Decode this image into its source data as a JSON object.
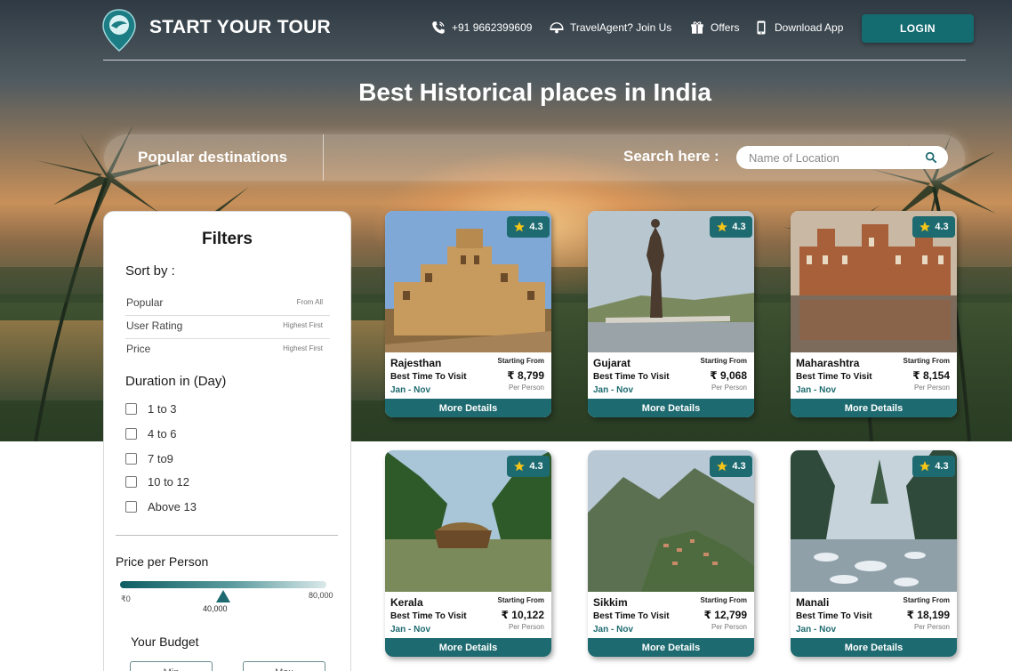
{
  "header": {
    "brand": "START YOUR TOUR",
    "phone": "+91 9662399609",
    "travel_agent": "TravelAgent? Join Us",
    "offers": "Offers",
    "download_app": "Download App",
    "login": "LOGIN"
  },
  "page_title": "Best Historical places in India",
  "search_bar": {
    "popular": "Popular destinations",
    "label": "Search here :",
    "placeholder": "Name of Location"
  },
  "filters": {
    "title": "Filters",
    "sort_by": "Sort by :",
    "sort_options": [
      {
        "label": "Popular",
        "hint": "From All"
      },
      {
        "label": "User Rating",
        "hint": "Highest First"
      },
      {
        "label": "Price",
        "hint": "Highest First"
      }
    ],
    "duration_title": "Duration in (Day)",
    "durations": [
      "1 to 3",
      "4 to 6",
      "7 to9",
      "10 to 12",
      "Above 13"
    ],
    "price_title": "Price per Person",
    "price_min": "₹0",
    "price_max": "80,000",
    "price_value": "40,000",
    "price_fraction": 0.5,
    "budget_title": "Your Budget",
    "budget_min": "Min",
    "budget_max": "Max"
  },
  "cards": [
    {
      "name": "Rajesthan",
      "rating": "4.3",
      "best": "Best Time To Visit",
      "months": "Jan - Nov",
      "from": "Starting From",
      "price": "₹ 8,799",
      "per": "Per Person",
      "button": "More Details"
    },
    {
      "name": "Gujarat",
      "rating": "4.3",
      "best": "Best Time To Visit",
      "months": "Jan - Nov",
      "from": "Starting From",
      "price": "₹ 9,068",
      "per": "Per Person",
      "button": "More Details"
    },
    {
      "name": "Maharashtra",
      "rating": "4.3",
      "best": "Best Time To Visit",
      "months": "Jan - Nov",
      "from": "Starting From",
      "price": "₹ 8,154",
      "per": "Per Person",
      "button": "More Details"
    },
    {
      "name": "Kerala",
      "rating": "4.3",
      "best": "Best Time To Visit",
      "months": "Jan - Nov",
      "from": "Starting From",
      "price": "₹ 10,122",
      "per": "Per Person",
      "button": "More Details"
    },
    {
      "name": "Sikkim",
      "rating": "4.3",
      "best": "Best Time To Visit",
      "months": "Jan - Nov",
      "from": "Starting From",
      "price": "₹ 12,799",
      "per": "Per Person",
      "button": "More Details"
    },
    {
      "name": "Manali",
      "rating": "4.3",
      "best": "Best Time To Visit",
      "months": "Jan - Nov",
      "from": "Starting From",
      "price": "₹ 18,199",
      "per": "Per Person",
      "button": "More Details"
    }
  ],
  "colors": {
    "accent": "#1d6a70",
    "login": "#146b70"
  }
}
